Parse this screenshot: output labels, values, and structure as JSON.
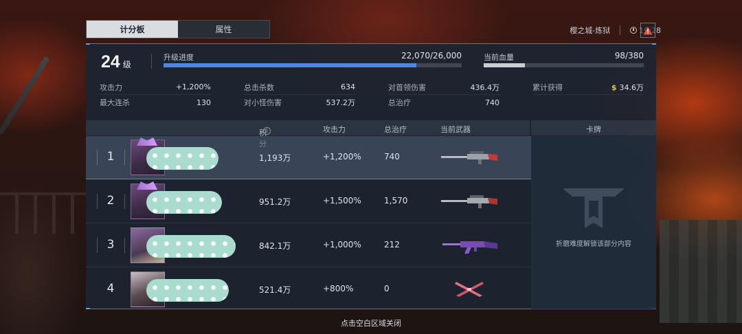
{
  "tabs": [
    {
      "label": "计分板",
      "active": true
    },
    {
      "label": "属性",
      "active": false
    }
  ],
  "header": {
    "map_name": "樱之城-炼狱",
    "time": "19:28"
  },
  "player": {
    "level": "24",
    "level_unit": "级",
    "upgrade_label": "升级进度",
    "upgrade_value": "22,070/26,000",
    "upgrade_fraction": 0.849,
    "hp_label": "当前血量",
    "hp_value": "98/380",
    "hp_fraction": 0.258
  },
  "stats": [
    {
      "label": "攻击力",
      "value": "+1,200%"
    },
    {
      "label": "总击杀数",
      "value": "634"
    },
    {
      "label": "对首领伤害",
      "value": "436.4万"
    },
    {
      "label": "累计获得",
      "value": "34.6万"
    },
    {
      "label": "最大连杀",
      "value": "130"
    },
    {
      "label": "对小怪伤害",
      "value": "537.2万"
    },
    {
      "label": "总治疗",
      "value": "740"
    }
  ],
  "table": {
    "headers": {
      "score": "积分",
      "attack": "攻击力",
      "heal": "总治疗",
      "weapon": "当前武器",
      "card": "卡牌"
    },
    "rows": [
      {
        "rank": "1",
        "score": "1,193万",
        "attack": "+1,200%",
        "heal": "740",
        "weapon": "sniper-rifle-icon"
      },
      {
        "rank": "2",
        "score": "951.2万",
        "attack": "+1,500%",
        "heal": "1,570",
        "weapon": "sniper-rifle-icon"
      },
      {
        "rank": "3",
        "score": "842.1万",
        "attack": "+1,000%",
        "heal": "212",
        "weapon": "assault-rifle-icon"
      },
      {
        "rank": "4",
        "score": "521.4万",
        "attack": "+800%",
        "heal": "0",
        "weapon": "dual-blades-icon"
      }
    ]
  },
  "card_panel": {
    "locked_text": "折磨难度解锁该部分内容"
  },
  "bottom_hint": "点击空白区域关闭",
  "colors": {
    "progress": "#4f86e0",
    "hp": "#c9cdd2",
    "accent": "#4a78c0",
    "coin": "#e8c24a"
  }
}
